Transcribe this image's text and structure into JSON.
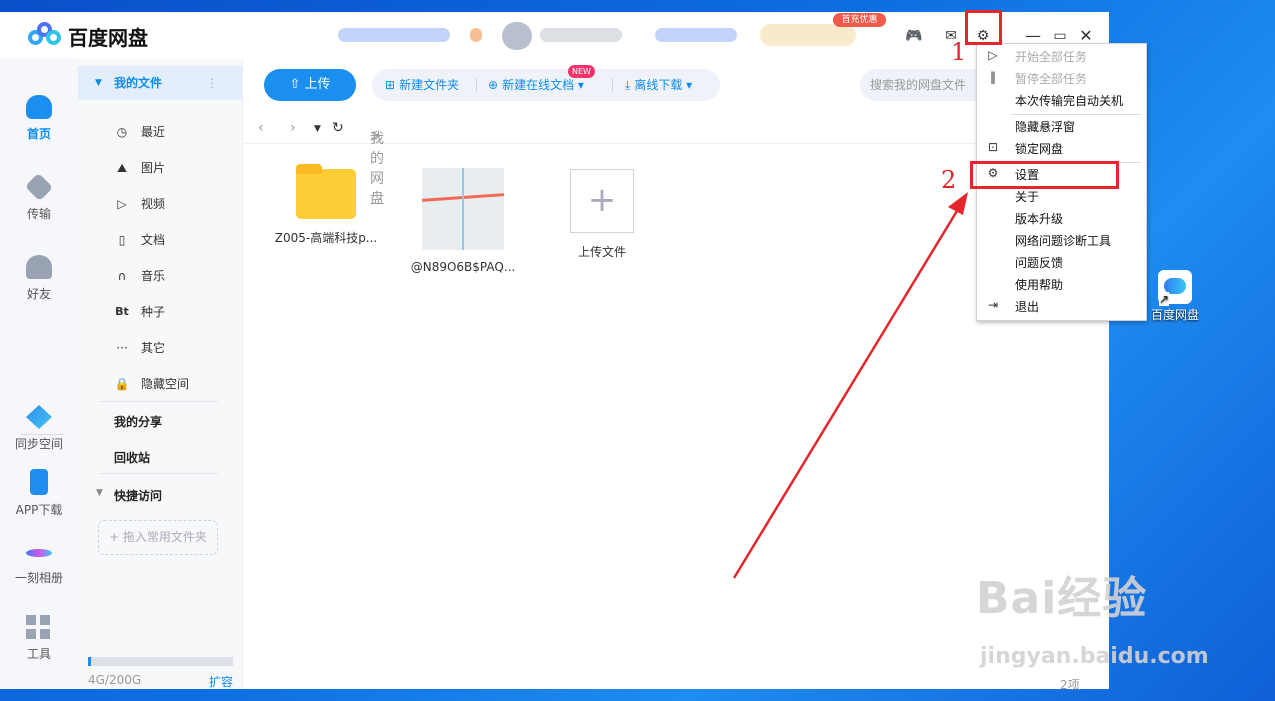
{
  "window": {
    "app_title": "百度网盘",
    "promo_badge": "首充优惠"
  },
  "annotations": {
    "step1": "1",
    "step2": "2"
  },
  "left_nav": {
    "items": [
      {
        "label": "首页",
        "icon": "cloud-icon"
      },
      {
        "label": "传输",
        "icon": "transfer-icon"
      },
      {
        "label": "好友",
        "icon": "friends-icon"
      },
      {
        "label": "同步空间",
        "icon": "sync-icon"
      },
      {
        "label": "APP下载",
        "icon": "phone-icon"
      },
      {
        "label": "一刻相册",
        "icon": "album-icon"
      },
      {
        "label": "工具",
        "icon": "tools-icon"
      }
    ]
  },
  "sidebar": {
    "my_files": "我的文件",
    "categories": [
      {
        "label": "最近",
        "icon": "clock-icon"
      },
      {
        "label": "图片",
        "icon": "image-icon"
      },
      {
        "label": "视频",
        "icon": "play-icon"
      },
      {
        "label": "文档",
        "icon": "document-icon"
      },
      {
        "label": "音乐",
        "icon": "headphone-icon"
      },
      {
        "label": "种子",
        "icon": "bt-icon"
      },
      {
        "label": "其它",
        "icon": "more-icon"
      },
      {
        "label": "隐藏空间",
        "icon": "lock-icon"
      }
    ],
    "my_share": "我的分享",
    "recycle_bin": "回收站",
    "quick_access": "快捷访问",
    "drop_hint": "+ 拖入常用文件夹",
    "quota_text": "4G/200G",
    "quota_fraction": 0.02,
    "expand": "扩容"
  },
  "toolbar": {
    "upload": "上传",
    "new_folder": "新建文件夹",
    "new_online_doc": "新建在线文档",
    "new_badge": "NEW",
    "offline_download": "离线下载",
    "search_placeholder": "搜索我的网盘文件"
  },
  "breadcrumb": {
    "root": "我的网盘",
    "sep": ">"
  },
  "files": [
    {
      "name": "Z005-高端科技p...",
      "type": "folder"
    },
    {
      "name": "@N89O6B$PAQ...",
      "type": "image"
    },
    {
      "name": "上传文件",
      "type": "upload"
    }
  ],
  "item_count": "2项",
  "settings_menu": {
    "items": [
      {
        "label": "开始全部任务",
        "disabled": true
      },
      {
        "label": "暂停全部任务",
        "disabled": true
      },
      {
        "label": "本次传输完自动关机",
        "disabled": false
      },
      {
        "label": "隐藏悬浮窗",
        "disabled": false
      },
      {
        "label": "锁定网盘",
        "disabled": false
      },
      {
        "label": "设置",
        "disabled": false
      },
      {
        "label": "关于",
        "disabled": false
      },
      {
        "label": "版本升级",
        "disabled": false
      },
      {
        "label": "网络问题诊断工具",
        "disabled": false
      },
      {
        "label": "问题反馈",
        "disabled": false
      },
      {
        "label": "使用帮助",
        "disabled": false
      },
      {
        "label": "退出",
        "disabled": false
      }
    ]
  },
  "desktop": {
    "shortcut_label": "百度网盘"
  },
  "watermark": {
    "main": "Bai经验",
    "sub": "jingyan.baidu.com"
  },
  "colors": {
    "accent": "#1a8fef",
    "annotation_red": "#e4262c"
  }
}
